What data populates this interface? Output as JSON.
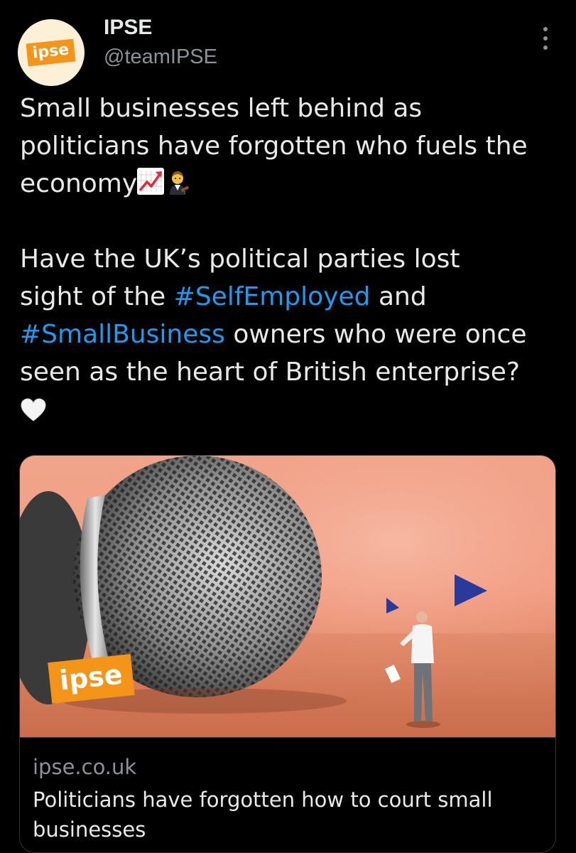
{
  "author": {
    "name": "IPSE",
    "handle": "@teamIPSE",
    "avatar_logo_text": "ipse"
  },
  "tweet": {
    "line1": "Small businesses left behind as",
    "line2": "politicians have forgotten who fuels the",
    "line3_text": "economy",
    "line3_emojis": [
      "chart-increasing-emoji",
      "judge-emoji"
    ],
    "para2_a": "Have the UK’s political parties lost",
    "para2_b": "sight of the ",
    "hashtag1": "#SelfEmployed",
    "para2_c": " and",
    "hashtag2": "#SmallBusiness",
    "para2_d": " owners who were once",
    "para2_e": "seen as the heart of British enterprise?",
    "closing_emoji": "white-heart-emoji"
  },
  "card": {
    "image_badge": "ipse",
    "domain": "ipse.co.uk",
    "title": "Politicians have forgotten how to court small businesses"
  },
  "colors": {
    "background": "#000000",
    "text": "#e7e9ea",
    "secondary_text": "#8b9299",
    "link": "#1d9bf0",
    "brand_orange": "#f4951a"
  }
}
